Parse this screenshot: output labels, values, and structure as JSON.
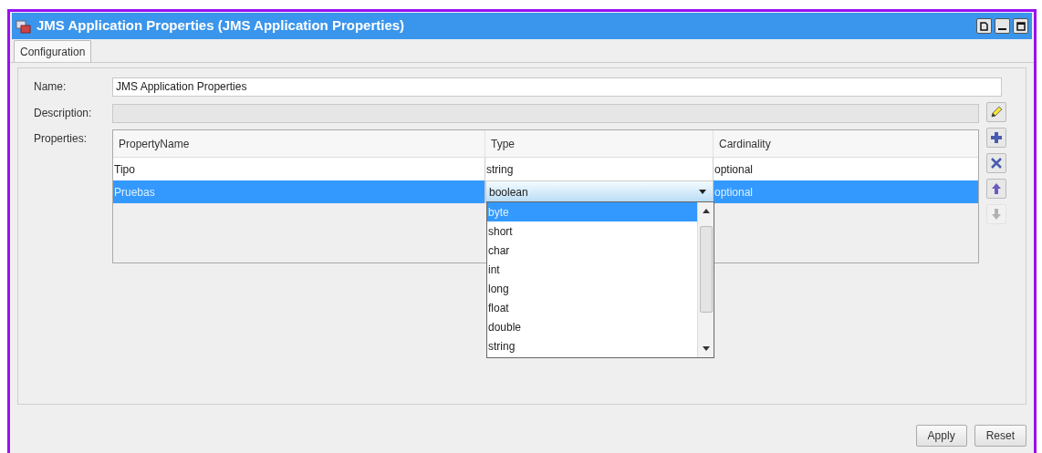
{
  "window": {
    "title": "JMS Application Properties (JMS Application Properties)"
  },
  "tabs": [
    {
      "label": "Configuration",
      "selected": true
    }
  ],
  "form": {
    "name_label": "Name:",
    "name_value": "JMS Application Properties",
    "description_label": "Description:",
    "properties_label": "Properties:"
  },
  "side_buttons": [
    {
      "kind": "edit",
      "disabled": false
    },
    {
      "kind": "add",
      "disabled": false
    },
    {
      "kind": "remove",
      "disabled": false
    },
    {
      "kind": "up",
      "disabled": false
    },
    {
      "kind": "down",
      "disabled": true
    }
  ],
  "table": {
    "columns": [
      "PropertyName",
      "Type",
      "Cardinality"
    ],
    "rows": [
      {
        "cells": [
          "Tipo",
          "string",
          "optional"
        ],
        "selected": false
      },
      {
        "cells": [
          "Pruebas",
          "boolean",
          "optional"
        ],
        "selected": true,
        "editing": true
      }
    ]
  },
  "dropdown": {
    "options": [
      {
        "label": "byte",
        "selected": true
      },
      {
        "label": "short",
        "selected": false
      },
      {
        "label": "char",
        "selected": false
      },
      {
        "label": "int",
        "selected": false
      },
      {
        "label": "long",
        "selected": false
      },
      {
        "label": "float",
        "selected": false
      },
      {
        "label": "double",
        "selected": false
      },
      {
        "label": "string",
        "selected": false
      }
    ]
  },
  "buttons": [
    "Apply",
    "Reset"
  ]
}
